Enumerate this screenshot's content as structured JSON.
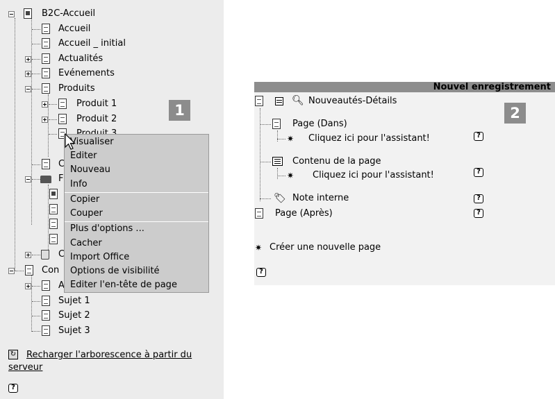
{
  "tree": {
    "root": "B2C-Accueil",
    "items": {
      "accueil": "Accueil",
      "accueil_initial": "Accueil _ initial",
      "actualites": "Actualités",
      "evenements": "Evénements",
      "produits": "Produits",
      "produit1": "Produit 1",
      "produit2": "Produit 2",
      "produit3_partial": "Produit 3",
      "c_partial": "C",
      "f_partial": "F",
      "c2_partial": "C",
      "contact_partial": "Con",
      "a_partial": "A",
      "sujet1": "Sujet 1",
      "sujet2": "Sujet 2",
      "sujet3": "Sujet 3"
    },
    "reload_link": "Recharger l'arborescence à partir du serveur",
    "badge": "1"
  },
  "context_menu": {
    "items": [
      "Visualiser",
      "Editer",
      "Nouveau",
      "Info",
      "Copier",
      "Couper",
      "Plus d'options ...",
      "Cacher",
      "Import Office",
      "Options de visibilité",
      "Editer l'en-tête de page"
    ]
  },
  "panel2": {
    "header": "Nouvel enregistrement",
    "badge": "2",
    "title": "Nouveautés-Détails",
    "page_dans": "Page (Dans)",
    "assistant1": "Cliquez ici pour l'assistant!",
    "contenu": "Contenu de la page",
    "assistant2": "Cliquez ici pour l'assistant!",
    "note": "Note interne",
    "page_apres": "Page (Après)",
    "create_page": "Créer une nouvelle page"
  },
  "help_glyph": "?"
}
